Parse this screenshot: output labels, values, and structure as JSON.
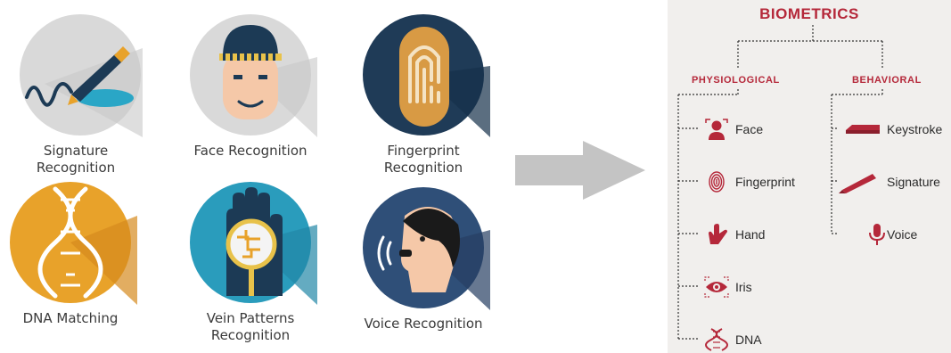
{
  "left_icons": [
    {
      "id": "signature",
      "label": "Signature\nRecognition",
      "icon": "signature-pen-icon",
      "bg": "#d9d9d9",
      "accent": "#2aa6c6"
    },
    {
      "id": "face",
      "label": "Face Recognition",
      "icon": "face-icon",
      "bg": "#d9d9d9",
      "accent": "#f5c8a8"
    },
    {
      "id": "fingerprint",
      "label": "Fingerprint\nRecognition",
      "icon": "fingerprint-icon",
      "bg": "#1f3b57",
      "accent": "#d89a44"
    },
    {
      "id": "dna",
      "label": "DNA Matching",
      "icon": "dna-icon",
      "bg": "#e8a22a",
      "accent": "#ffffff"
    },
    {
      "id": "vein",
      "label": "Vein Patterns\nRecognition",
      "icon": "vein-hand-icon",
      "bg": "#2a9cbc",
      "accent": "#1c3a55"
    },
    {
      "id": "voice",
      "label": "Voice Recognition",
      "icon": "voice-head-icon",
      "bg": "#2f4f78",
      "accent": "#f5c8a8"
    }
  ],
  "arrow": {
    "icon": "right-arrow-icon",
    "color": "#c4c4c4"
  },
  "biometrics": {
    "title": "BIOMETRICS",
    "accent": "#b5283a",
    "physiological": {
      "label": "PHYSIOLOGICAL",
      "items": [
        {
          "label": "Face",
          "icon": "face-scan-icon"
        },
        {
          "label": "Fingerprint",
          "icon": "fingerprint-icon"
        },
        {
          "label": "Hand",
          "icon": "hand-icon"
        },
        {
          "label": "Iris",
          "icon": "eye-icon"
        },
        {
          "label": "DNA",
          "icon": "dna-icon"
        }
      ]
    },
    "behavioral": {
      "label": "BEHAVIORAL",
      "items": [
        {
          "label": "Keystroke",
          "icon": "keyboard-icon"
        },
        {
          "label": "Signature",
          "icon": "pen-icon"
        },
        {
          "label": "Voice",
          "icon": "microphone-icon"
        }
      ]
    }
  }
}
